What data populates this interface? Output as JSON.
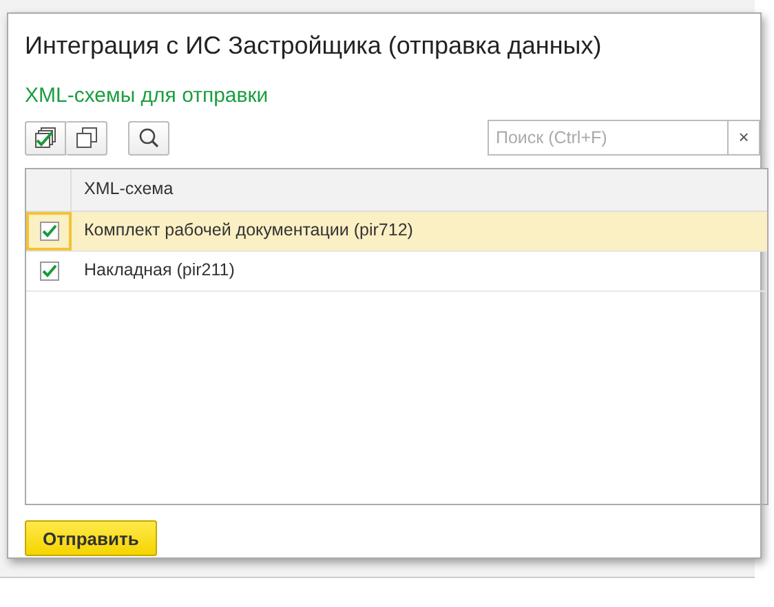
{
  "window": {
    "title": "Интеграция с ИС Застройщика (отправка данных)"
  },
  "section_title": "XML-схемы для отправки",
  "toolbar": {
    "search": {
      "placeholder": "Поиск (Ctrl+F)",
      "clear": "×"
    }
  },
  "table": {
    "columns": [
      "XML-схема"
    ],
    "rows": [
      {
        "name": "Комплект рабочей документации (pir712)",
        "checked": true,
        "selected": true
      },
      {
        "name": "Накладная (pir211)",
        "checked": true,
        "selected": false
      }
    ]
  },
  "buttons": [
    {
      "label": "Отправить"
    }
  ]
}
